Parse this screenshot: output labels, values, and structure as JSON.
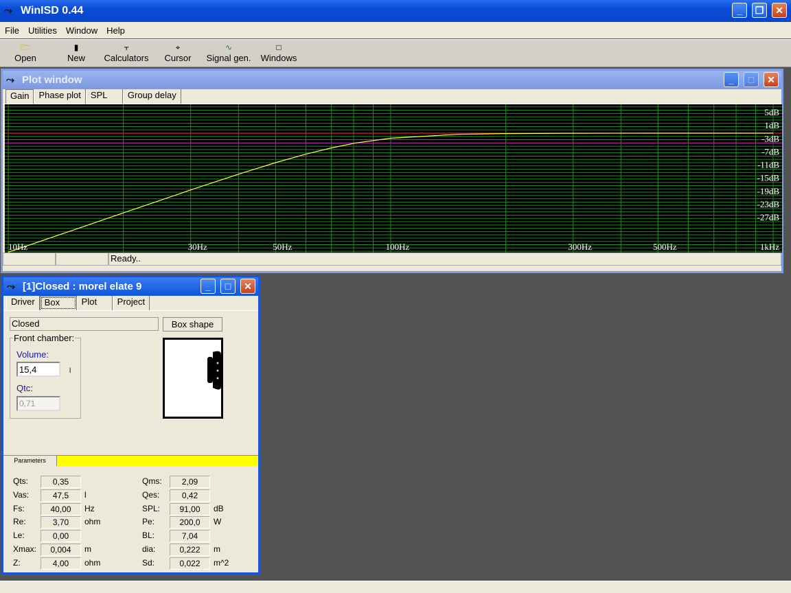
{
  "app": {
    "title": "WinISD 0.44"
  },
  "menu": [
    "File",
    "Utilities",
    "Window",
    "Help"
  ],
  "toolbar": [
    {
      "label": "Open",
      "icon": "folder-open-icon"
    },
    {
      "label": "New",
      "icon": "new-document-icon"
    },
    {
      "label": "Calculators",
      "icon": "calculator-icon"
    },
    {
      "label": "Cursor",
      "icon": "crosshair-icon"
    },
    {
      "label": "Signal gen.",
      "icon": "signal-wave-icon"
    },
    {
      "label": "Windows",
      "icon": "window-icon"
    }
  ],
  "plot_window": {
    "title": "Plot window",
    "tabs": [
      "Gain",
      "Phase plot",
      "SPL",
      "Group delay"
    ],
    "selected_tab": "Gain",
    "status": [
      "",
      "",
      "Ready.."
    ]
  },
  "chart_data": {
    "type": "line",
    "x_scale": "log",
    "xlim": [
      10,
      1000
    ],
    "ylim": [
      -36,
      9
    ],
    "x_ticks": [
      {
        "v": 10,
        "label": "10Hz"
      },
      {
        "v": 30,
        "label": "30Hz"
      },
      {
        "v": 50,
        "label": "50Hz"
      },
      {
        "v": 100,
        "label": "100Hz"
      },
      {
        "v": 300,
        "label": "300Hz"
      },
      {
        "v": 500,
        "label": "500Hz"
      },
      {
        "v": 1000,
        "label": "1kHz"
      }
    ],
    "y_ticks": [
      {
        "v": 5,
        "label": "5dB"
      },
      {
        "v": 1,
        "label": "1dB"
      },
      {
        "v": -3,
        "label": "-3dB"
      },
      {
        "v": -7,
        "label": "-7dB"
      },
      {
        "v": -11,
        "label": "-11dB"
      },
      {
        "v": -15,
        "label": "-15dB"
      },
      {
        "v": -19,
        "label": "-19dB"
      },
      {
        "v": -23,
        "label": "-23dB"
      },
      {
        "v": -27,
        "label": "-27dB"
      }
    ],
    "reference_lines": [
      {
        "y": 0,
        "color": "#e02020"
      },
      {
        "y": -3,
        "color": "#a020a0"
      }
    ],
    "grid": true,
    "background": "#000000",
    "grid_color": "#1f8a1f",
    "line_color": "#ffff40",
    "series": [
      {
        "x": [
          10,
          15,
          20,
          30,
          40,
          50,
          60,
          70,
          81,
          100,
          150,
          200,
          300,
          500,
          1000
        ],
        "y": [
          -36.3,
          -29.3,
          -24.3,
          -17.3,
          -12.5,
          -9.0,
          -6.4,
          -4.5,
          -3.0,
          -1.55,
          -0.35,
          -0.12,
          -0.02,
          0,
          0
        ]
      }
    ]
  },
  "project_window": {
    "title": "[1]Closed : morel elate 9",
    "tabs": [
      "Driver",
      "Box",
      "Plot",
      "Project"
    ],
    "selected_tab": "Box",
    "box_type": "Closed",
    "box_shape_button": "Box shape",
    "front_chamber_label": "Front chamber:",
    "volume_label": "Volume:",
    "volume_value": "15,4",
    "volume_unit": "l",
    "qtc_label": "Qtc:",
    "qtc_value": "0,71",
    "params_tab": "Parameters",
    "params_bar_color": "#ffff00",
    "params_left": [
      {
        "k": "Qts:",
        "v": "0,35",
        "u": ""
      },
      {
        "k": "Vas:",
        "v": "47,5",
        "u": "l"
      },
      {
        "k": "Fs:",
        "v": "40,00",
        "u": "Hz"
      },
      {
        "k": "Re:",
        "v": "3,70",
        "u": "ohm"
      },
      {
        "k": "Le:",
        "v": "0,00",
        "u": ""
      },
      {
        "k": "Xmax:",
        "v": "0,004",
        "u": "m"
      },
      {
        "k": "Z:",
        "v": "4,00",
        "u": "ohm"
      }
    ],
    "params_right": [
      {
        "k": "Qms:",
        "v": "2,09",
        "u": ""
      },
      {
        "k": "Qes:",
        "v": "0,42",
        "u": ""
      },
      {
        "k": "SPL:",
        "v": "91,00",
        "u": "dB"
      },
      {
        "k": "Pe:",
        "v": "200,0",
        "u": "W"
      },
      {
        "k": "BL:",
        "v": "7,04",
        "u": ""
      },
      {
        "k": "dia:",
        "v": "0,222",
        "u": "m"
      },
      {
        "k": "Sd:",
        "v": "0,022",
        "u": "m^2"
      }
    ]
  }
}
